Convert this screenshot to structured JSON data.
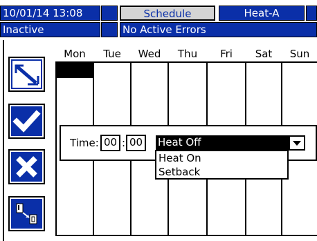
{
  "status_bar": {
    "datetime": "10/01/14 13:08",
    "screen_title": "Schedule",
    "zone": "Heat-A",
    "state": "Inactive",
    "errors": "No Active Errors"
  },
  "schedule": {
    "days": [
      "Mon",
      "Tue",
      "Wed",
      "Thu",
      "Fri",
      "Sat",
      "Sun"
    ]
  },
  "dialog": {
    "time_label": "Time:",
    "hour": "00",
    "separator": ":",
    "minute": "00",
    "selected_option": "Heat Off",
    "options": [
      "Heat On",
      "Setback"
    ]
  },
  "icons": {
    "edit": "edit-pen-icon",
    "confirm": "checkmark-icon",
    "cancel": "x-cancel-icon",
    "copy": "copy-schedule-icon"
  },
  "colors": {
    "bar_blue": "#0a2fa8",
    "tab_grey": "#d4d4d4",
    "white": "#ffffff",
    "black": "#000000"
  }
}
